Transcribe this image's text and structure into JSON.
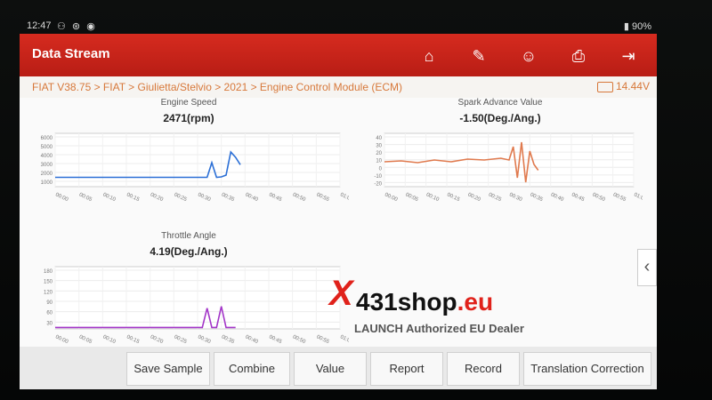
{
  "status": {
    "time": "12:47",
    "icons_text": "⚇ ⊛ ◉",
    "battery": "90%"
  },
  "header": {
    "title": "Data Stream"
  },
  "toolbar": [
    "home-icon",
    "report-edit-icon",
    "support-icon",
    "print-icon",
    "exit-icon"
  ],
  "breadcrumb": "FIAT V38.75 > FIAT > Giulietta/Stelvio > 2021 > Engine Control Module (ECM)",
  "voltage": "14.44V",
  "watermark": {
    "x": "X",
    "brand": "431shop",
    "tld": ".eu",
    "tagline": "LAUNCH Authorized EU Dealer"
  },
  "bottom_buttons": [
    "Save Sample",
    "Combine",
    "Value",
    "Report",
    "Record",
    "Translation Correction"
  ],
  "colors": {
    "header_red": "#c9231a",
    "crumb_orange": "#d7783a",
    "engine_line": "#2b6fd6",
    "spark_line": "#e07a4e",
    "throttle_line": "#a336c8"
  },
  "chart_data": [
    {
      "type": "line",
      "title": "Engine Speed",
      "value_label": "2471(rpm)",
      "ylim": [
        0,
        6000
      ],
      "yticks": [
        "6000",
        "5000",
        "4000",
        "3000",
        "2000",
        "1000"
      ],
      "xticks": [
        "00:00",
        "00:05",
        "00:10",
        "00:15",
        "00:20",
        "00:25",
        "00:30",
        "00:35",
        "00:40",
        "00:45",
        "00:50",
        "00:55",
        "01:00"
      ],
      "x": [
        0,
        32,
        33,
        34,
        35,
        36,
        37,
        38,
        39
      ],
      "values": [
        1050,
        1050,
        2700,
        1050,
        1100,
        1300,
        3900,
        3300,
        2471
      ]
    },
    {
      "type": "line",
      "title": "Spark Advance Value",
      "value_label": "-1.50(Deg./Ang.)",
      "ylim": [
        -20,
        40
      ],
      "yticks": [
        "40",
        "30",
        "20",
        "10",
        "0",
        "-10",
        "-20"
      ],
      "xticks": [
        "00:00",
        "00:05",
        "00:10",
        "00:15",
        "00:20",
        "00:25",
        "00:30",
        "00:35",
        "00:40",
        "00:45",
        "00:50",
        "00:55",
        "01:00"
      ],
      "x": [
        0,
        4,
        8,
        12,
        16,
        20,
        24,
        28,
        30,
        31,
        32,
        33,
        34,
        35,
        36,
        37
      ],
      "values": [
        8,
        9,
        7,
        10,
        8,
        11,
        10,
        12,
        10,
        25,
        -10,
        30,
        -15,
        20,
        5,
        -1.5
      ]
    },
    {
      "type": "line",
      "title": "Throttle Angle",
      "value_label": "4.19(Deg./Ang.)",
      "ylim": [
        0,
        180
      ],
      "yticks": [
        "180",
        "150",
        "120",
        "90",
        "60",
        "30"
      ],
      "xticks": [
        "00:00",
        "00:05",
        "00:10",
        "00:15",
        "00:20",
        "00:25",
        "00:30",
        "00:35",
        "00:40",
        "00:45",
        "00:50",
        "00:55",
        "01:00"
      ],
      "x": [
        0,
        31,
        32,
        33,
        34,
        35,
        36,
        37,
        38
      ],
      "values": [
        4,
        4,
        60,
        4,
        4,
        65,
        4,
        4,
        4.19
      ]
    }
  ]
}
